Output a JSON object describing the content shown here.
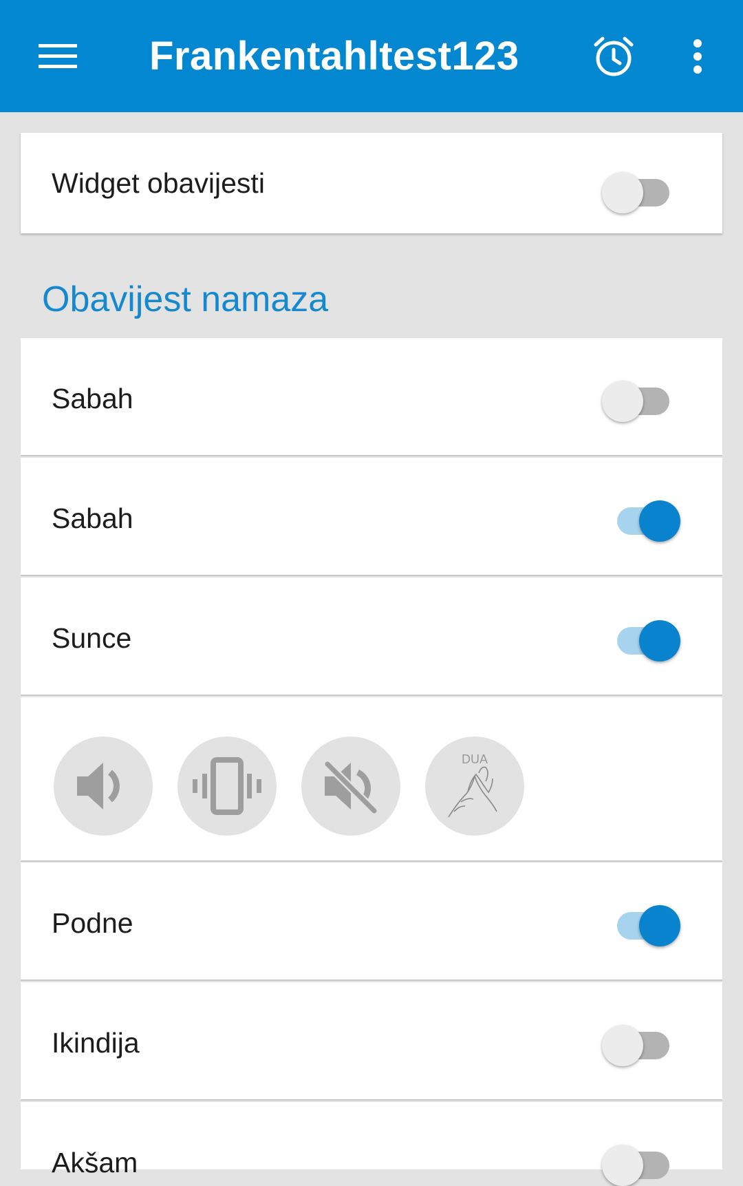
{
  "appbar": {
    "title": "Frankentahltest123",
    "icons": [
      "menu-icon",
      "alarm-clock-icon",
      "more-vert-icon"
    ],
    "color": "#0487d1"
  },
  "widget": {
    "label": "Widget obavijesti",
    "enabled": false
  },
  "section": {
    "title": "Obavijest namaza",
    "color": "#1589d0"
  },
  "prayers": [
    {
      "label": "Sabah",
      "enabled": false
    },
    {
      "label": "Sabah",
      "enabled": true
    },
    {
      "label": "Sunce",
      "enabled": true
    },
    {
      "label": "Podne",
      "enabled": true
    },
    {
      "label": "Ikindija",
      "enabled": false
    },
    {
      "label": "Akšam",
      "enabled": false
    }
  ],
  "sound_options": [
    {
      "icon": "volume-up-icon"
    },
    {
      "icon": "vibrate-icon"
    },
    {
      "icon": "volume-off-icon"
    },
    {
      "icon": "dua-hands-icon",
      "label": "DUA"
    }
  ],
  "switch_colors": {
    "on_thumb": "#0a83cf",
    "on_track": "#a7d3ef",
    "off_thumb": "#ececec",
    "off_track": "#b3b3b3"
  }
}
